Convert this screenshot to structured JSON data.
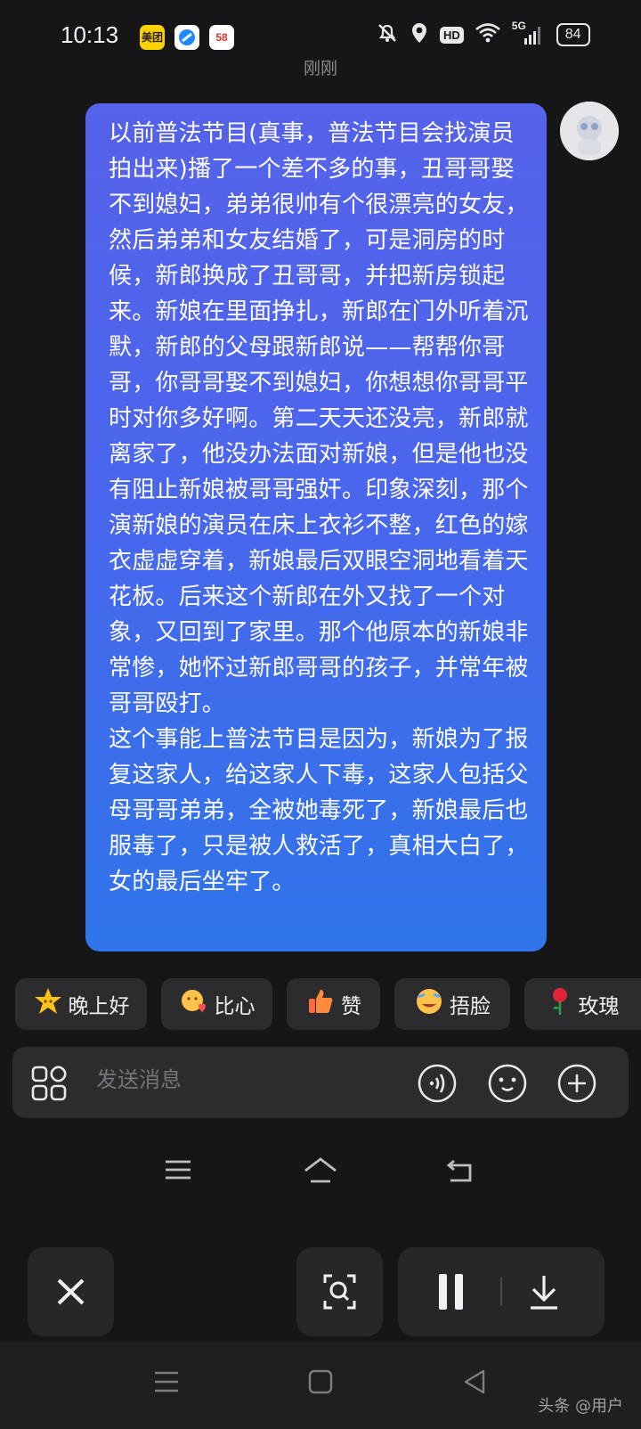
{
  "status_bar": {
    "time": "10:13",
    "app_icons": [
      "美团",
      "browser-icon",
      "58"
    ],
    "network": "5G",
    "battery": "84"
  },
  "chat": {
    "timestamp": "刚刚",
    "message": "以前普法节目(真事，普法节目会找演员拍出来)播了一个差不多的事，丑哥哥娶不到媳妇，弟弟很帅有个很漂亮的女友，然后弟弟和女友结婚了，可是洞房的时候，新郎换成了丑哥哥，并把新房锁起来。新娘在里面挣扎，新郎在门外听着沉默，新郎的父母跟新郎说——帮帮你哥哥，你哥哥娶不到媳妇，你想想你哥哥平时对你多好啊。第二天天还没亮，新郎就离家了，他没办法面对新娘，但是他也没有阻止新娘被哥哥强奸。印象深刻，那个演新娘的演员在床上衣衫不整，红色的嫁衣虚虚穿着，新娘最后双眼空洞地看着天花板。后来这个新郎在外又找了一个对象，又回到了家里。那个他原本的新娘非常惨，她怀过新郎哥哥的孩子，并常年被哥哥殴打。\n这个事能上普法节目是因为，新娘为了报复这家人，给这家人下毒，这家人包括父母哥哥弟弟，全被她毒死了，新娘最后也服毒了，只是被人救活了，真相大白了，女的最后坐牢了。"
  },
  "quick_replies": [
    {
      "icon": "star-face-icon",
      "label": "晚上好"
    },
    {
      "icon": "heart-hands-icon",
      "label": "比心"
    },
    {
      "icon": "thumbs-up-icon",
      "label": "赞"
    },
    {
      "icon": "facepalm-icon",
      "label": "捂脸"
    },
    {
      "icon": "rose-icon",
      "label": "玫瑰"
    }
  ],
  "input": {
    "placeholder": "发送消息"
  },
  "watermark": "头条 @用户"
}
